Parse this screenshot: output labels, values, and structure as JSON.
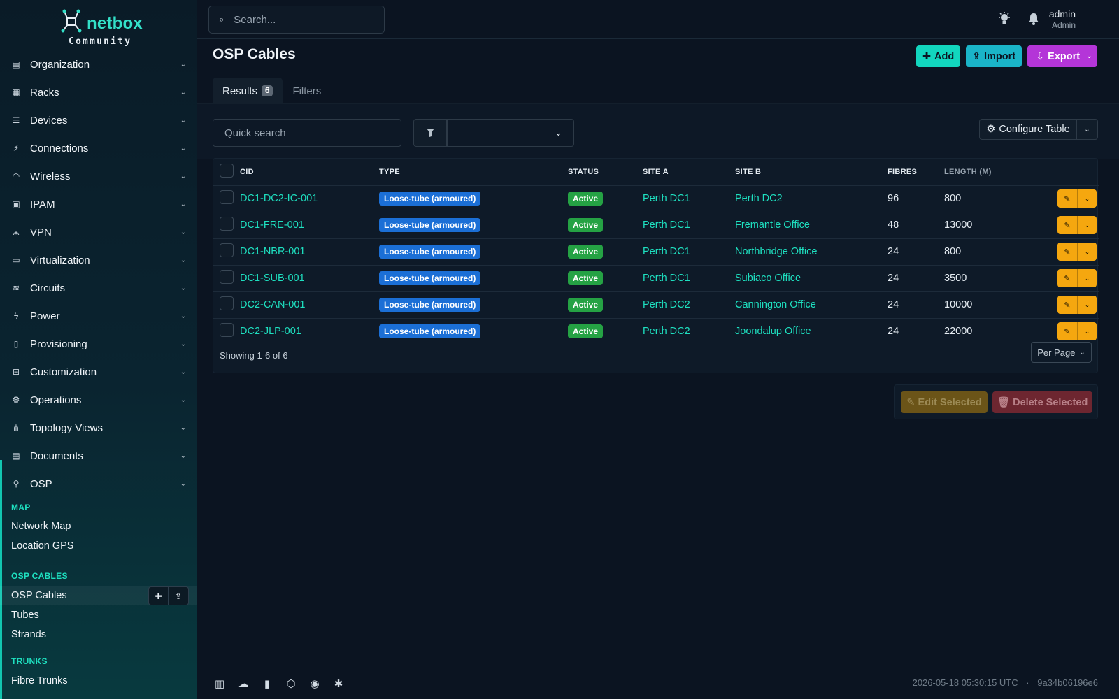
{
  "brand": {
    "name": "netbox",
    "edition": "Community"
  },
  "sidebar": {
    "menu": [
      {
        "label": "Organization",
        "icon": "building-icon"
      },
      {
        "label": "Racks",
        "icon": "rack-icon"
      },
      {
        "label": "Devices",
        "icon": "server-icon"
      },
      {
        "label": "Connections",
        "icon": "plug-icon"
      },
      {
        "label": "Wireless",
        "icon": "wifi-icon"
      },
      {
        "label": "IPAM",
        "icon": "ip-card-icon"
      },
      {
        "label": "VPN",
        "icon": "vpn-icon"
      },
      {
        "label": "Virtualization",
        "icon": "monitor-icon"
      },
      {
        "label": "Circuits",
        "icon": "circuit-icon"
      },
      {
        "label": "Power",
        "icon": "bolt-icon"
      },
      {
        "label": "Provisioning",
        "icon": "file-icon"
      },
      {
        "label": "Customization",
        "icon": "toolbox-icon"
      },
      {
        "label": "Operations",
        "icon": "gears-icon"
      },
      {
        "label": "Topology Views",
        "icon": "sitemap-icon"
      },
      {
        "label": "Documents",
        "icon": "documents-icon"
      },
      {
        "label": "OSP",
        "icon": "map-pin-icon"
      }
    ],
    "osp": {
      "map_heading": "MAP",
      "network_map": "Network Map",
      "location_gps": "Location GPS",
      "cables_heading": "OSP CABLES",
      "osp_cables": "OSP Cables",
      "tubes": "Tubes",
      "strands": "Strands",
      "trunks_heading": "TRUNKS",
      "fibre_trunks": "Fibre Trunks"
    }
  },
  "topbar": {
    "search_placeholder": "Search...",
    "user_name": "admin",
    "user_role": "Admin"
  },
  "page": {
    "title": "OSP Cables",
    "add_label": "Add",
    "import_label": "Import",
    "export_label": "Export"
  },
  "tabs": {
    "results_label": "Results",
    "results_count": "6",
    "filters_label": "Filters"
  },
  "toolbar": {
    "quick_search_placeholder": "Quick search",
    "configure_table_label": "Configure Table"
  },
  "table": {
    "headers": {
      "cid": "CID",
      "type": "TYPE",
      "status": "STATUS",
      "site_a": "SITE A",
      "site_b": "SITE B",
      "fibres": "FIBRES",
      "length": "LENGTH (M)"
    },
    "rows": [
      {
        "cid": "DC1-DC2-IC-001",
        "type": "Loose-tube (armoured)",
        "status": "Active",
        "site_a": "Perth DC1",
        "site_b": "Perth DC2",
        "fibres": "96",
        "length": "800"
      },
      {
        "cid": "DC1-FRE-001",
        "type": "Loose-tube (armoured)",
        "status": "Active",
        "site_a": "Perth DC1",
        "site_b": "Fremantle Office",
        "fibres": "48",
        "length": "13000"
      },
      {
        "cid": "DC1-NBR-001",
        "type": "Loose-tube (armoured)",
        "status": "Active",
        "site_a": "Perth DC1",
        "site_b": "Northbridge Office",
        "fibres": "24",
        "length": "800"
      },
      {
        "cid": "DC1-SUB-001",
        "type": "Loose-tube (armoured)",
        "status": "Active",
        "site_a": "Perth DC1",
        "site_b": "Subiaco Office",
        "fibres": "24",
        "length": "3500"
      },
      {
        "cid": "DC2-CAN-001",
        "type": "Loose-tube (armoured)",
        "status": "Active",
        "site_a": "Perth DC2",
        "site_b": "Cannington Office",
        "fibres": "24",
        "length": "10000"
      },
      {
        "cid": "DC2-JLP-001",
        "type": "Loose-tube (armoured)",
        "status": "Active",
        "site_a": "Perth DC2",
        "site_b": "Joondalup Office",
        "fibres": "24",
        "length": "22000"
      }
    ],
    "showing_text": "Showing 1-6 of 6",
    "per_page_label": "Per Page"
  },
  "bulk": {
    "edit_label": "Edit Selected",
    "delete_label": "Delete Selected"
  },
  "footer": {
    "timestamp": "2026-05-18 05:30:15 UTC",
    "separator": "·",
    "commit": "9a34b06196e6",
    "icons": [
      "book-icon",
      "cloud-download-icon",
      "bookmark-doc-icon",
      "graphql-icon",
      "github-icon",
      "slack-icon"
    ]
  },
  "colors": {
    "accent": "#1ee0c0",
    "background": "#0b1421",
    "type_badge": "#1b6fd6",
    "status_active": "#25a244",
    "add_button": "#12d6be",
    "import_button": "#1ab4c8",
    "export_button": "#b435d8",
    "edit_button": "#f5a70f"
  }
}
